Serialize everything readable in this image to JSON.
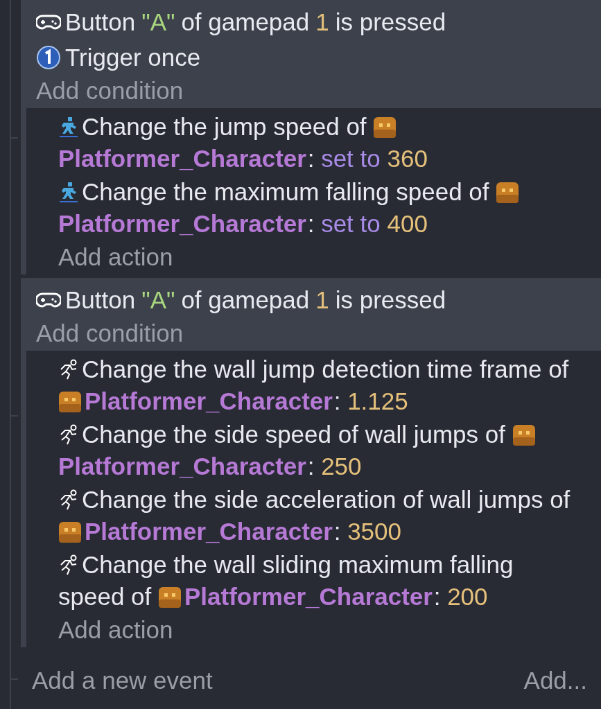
{
  "events": [
    {
      "conditions": [
        {
          "kind": "gamepad",
          "parts": [
            {
              "kind": "text",
              "text": "Button"
            },
            {
              "kind": "string",
              "text": "\"A\""
            },
            {
              "kind": "text",
              "text": "of gamepad"
            },
            {
              "kind": "number",
              "text": "1"
            },
            {
              "kind": "text",
              "text": "is pressed"
            }
          ]
        },
        {
          "kind": "trigger",
          "parts": [
            {
              "kind": "text",
              "text": "Trigger once"
            }
          ]
        }
      ],
      "add_condition": "Add condition",
      "actions": [
        {
          "kind": "jump",
          "parts": [
            {
              "kind": "text",
              "text": "Change the jump speed of"
            },
            {
              "kind": "object",
              "text": "Platformer_Character"
            },
            {
              "kind": "colon",
              "text": ":"
            },
            {
              "kind": "keyword",
              "text": "set to"
            },
            {
              "kind": "number",
              "text": "360"
            }
          ]
        },
        {
          "kind": "jump",
          "parts": [
            {
              "kind": "text",
              "text": "Change the maximum falling speed of"
            },
            {
              "kind": "object",
              "text": "Platformer_Character"
            },
            {
              "kind": "colon",
              "text": ":"
            },
            {
              "kind": "keyword",
              "text": "set to"
            },
            {
              "kind": "number",
              "text": "400"
            }
          ]
        }
      ],
      "add_action": "Add action"
    },
    {
      "conditions": [
        {
          "kind": "gamepad",
          "parts": [
            {
              "kind": "text",
              "text": "Button"
            },
            {
              "kind": "string",
              "text": "\"A\""
            },
            {
              "kind": "text",
              "text": "of gamepad"
            },
            {
              "kind": "number",
              "text": "1"
            },
            {
              "kind": "text",
              "text": "is pressed"
            }
          ]
        }
      ],
      "add_condition": "Add condition",
      "actions": [
        {
          "kind": "walljump",
          "parts": [
            {
              "kind": "text",
              "text": "Change the wall jump detection time frame"
            },
            {
              "kind": "text",
              "text": "of"
            },
            {
              "kind": "object",
              "text": "Platformer_Character"
            },
            {
              "kind": "colon",
              "text": ":"
            },
            {
              "kind": "number",
              "text": "1.125"
            }
          ]
        },
        {
          "kind": "walljump",
          "parts": [
            {
              "kind": "text",
              "text": "Change the side speed of wall jumps of"
            },
            {
              "kind": "object",
              "text": "Platformer_Character"
            },
            {
              "kind": "colon",
              "text": ":"
            },
            {
              "kind": "number",
              "text": "250"
            }
          ]
        },
        {
          "kind": "walljump",
          "parts": [
            {
              "kind": "text",
              "text": "Change the side acceleration of wall jumps"
            },
            {
              "kind": "text",
              "text": "of"
            },
            {
              "kind": "object",
              "text": "Platformer_Character"
            },
            {
              "kind": "colon",
              "text": ":"
            },
            {
              "kind": "number",
              "text": "3500"
            }
          ]
        },
        {
          "kind": "walljump",
          "parts": [
            {
              "kind": "text",
              "text": "Change the wall sliding maximum falling"
            },
            {
              "kind": "text",
              "text": "speed of"
            },
            {
              "kind": "object",
              "text": "Platformer_Character"
            },
            {
              "kind": "colon",
              "text": ":"
            },
            {
              "kind": "number",
              "text": "200"
            }
          ]
        }
      ],
      "add_action": "Add action"
    }
  ],
  "footer": {
    "add_event": "Add a new event",
    "add_menu": "Add..."
  }
}
